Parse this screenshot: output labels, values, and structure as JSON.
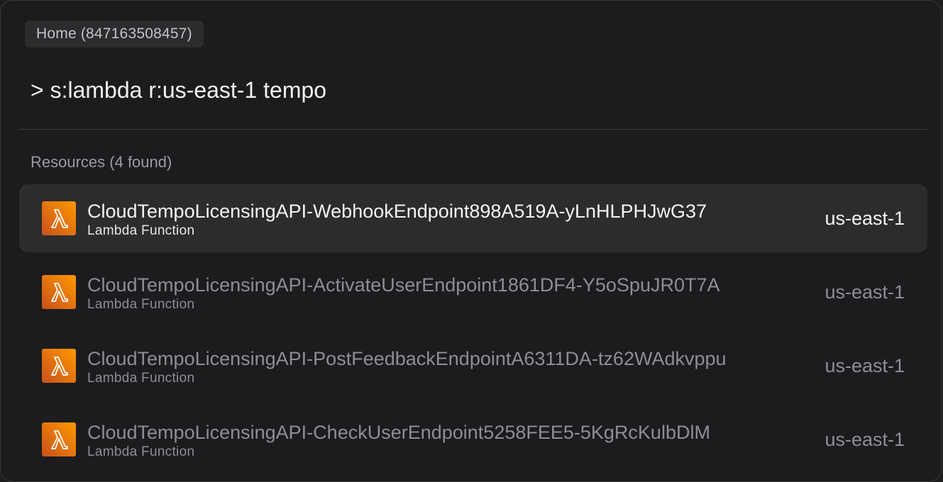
{
  "breadcrumb": {
    "label": "Home (847163508457)"
  },
  "search": {
    "query": "> s:lambda r:us-east-1 tempo"
  },
  "results": {
    "header": "Resources (4 found)",
    "items": [
      {
        "name": "CloudTempoLicensingAPI-WebhookEndpoint898A519A-yLnHLPHJwG37",
        "type": "Lambda Function",
        "region": "us-east-1",
        "icon": "lambda-icon",
        "selected": true
      },
      {
        "name": "CloudTempoLicensingAPI-ActivateUserEndpoint1861DF4-Y5oSpuJR0T7A",
        "type": "Lambda Function",
        "region": "us-east-1",
        "icon": "lambda-icon",
        "selected": false
      },
      {
        "name": "CloudTempoLicensingAPI-PostFeedbackEndpointA6311DA-tz62WAdkvppu",
        "type": "Lambda Function",
        "region": "us-east-1",
        "icon": "lambda-icon",
        "selected": false
      },
      {
        "name": "CloudTempoLicensingAPI-CheckUserEndpoint5258FEE5-5KgRcKulbDlM",
        "type": "Lambda Function",
        "region": "us-east-1",
        "icon": "lambda-icon",
        "selected": false
      }
    ]
  },
  "colors": {
    "panel_background": "#1c1c1e",
    "selected_row": "#2c2c2e",
    "lambda_orange_start": "#c8511b",
    "lambda_orange_end": "#ff9900"
  }
}
